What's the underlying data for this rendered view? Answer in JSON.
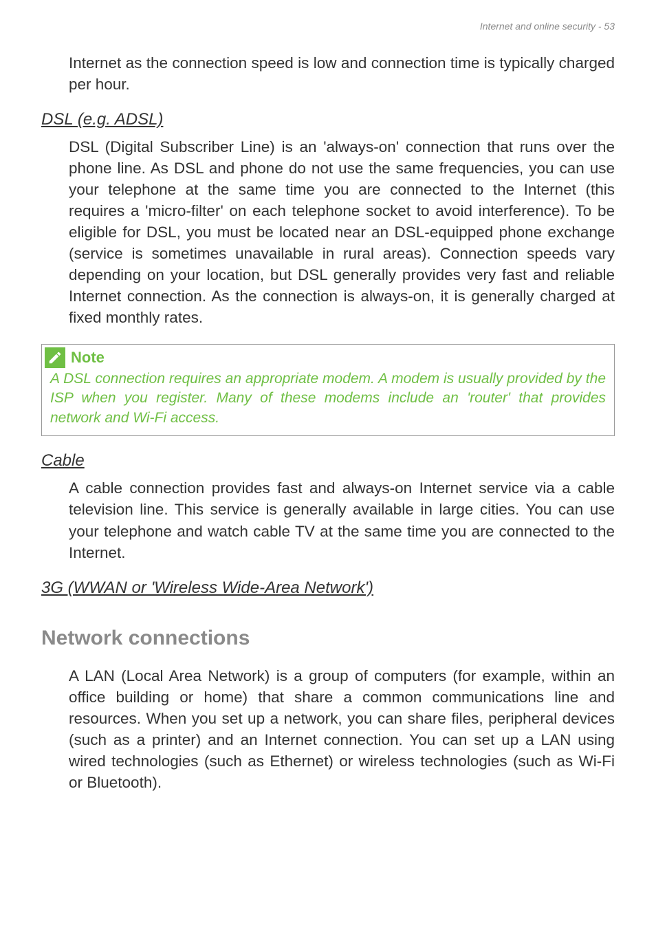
{
  "header": {
    "text": "Internet and online security - 53"
  },
  "intro_para": "Internet as the connection speed is low and connection time is typically charged per hour.",
  "dsl": {
    "heading": "DSL (e.g. ADSL)",
    "body": "DSL (Digital Subscriber Line) is an 'always-on' connection that runs over the phone line. As DSL and phone do not use the same frequencies, you can use your telephone at the same time you are connected to the Internet (this requires a 'micro-filter' on each telephone socket to avoid interference). To be eligible for DSL, you must be located near an DSL-equipped phone exchange (service is sometimes unavailable in rural areas). Connection speeds vary depending on your location, but DSL generally provides very fast and reliable Internet connection. As the connection is always-on, it is generally charged at fixed monthly rates."
  },
  "note": {
    "title": "Note",
    "body": "A DSL connection requires an appropriate modem. A modem is usually provided by the ISP when you register. Many of these modems include an 'router' that provides network and Wi-Fi access."
  },
  "cable": {
    "heading": "Cable",
    "body": "A cable connection provides fast and always-on Internet service via a cable television line. This service is generally available in large cities. You can use your telephone and watch cable TV at the same time you are connected to the Internet."
  },
  "threeg": {
    "heading": "3G (WWAN or 'Wireless Wide-Area Network')"
  },
  "network": {
    "heading": "Network connections",
    "body": "A LAN (Local Area Network) is a group of computers (for example, within an office building or home) that share a common communications line and resources. When you set up a network, you can share files, peripheral devices (such as a printer) and an Internet connection. You can set up a LAN using wired technologies (such as Ethernet) or wireless technologies (such as Wi-Fi or Bluetooth)."
  }
}
